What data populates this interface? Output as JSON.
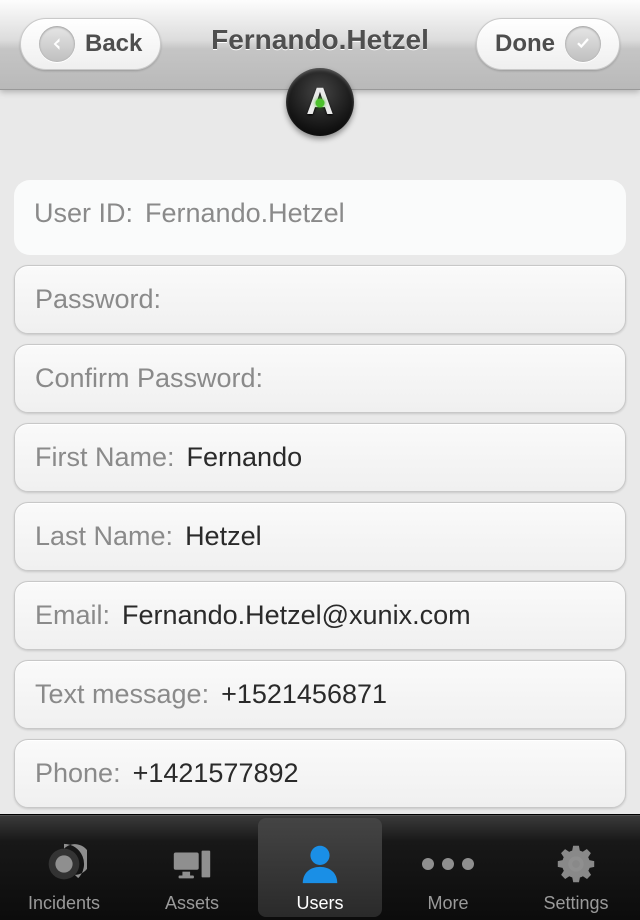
{
  "header": {
    "back_label": "Back",
    "done_label": "Done",
    "title": "Fernando.Hetzel"
  },
  "fields": {
    "user_id": {
      "label": "User ID:",
      "value": "Fernando.Hetzel"
    },
    "password": {
      "label": "Password:",
      "value": ""
    },
    "confirm": {
      "label": "Confirm Password:",
      "value": ""
    },
    "first_name": {
      "label": "First Name:",
      "value": "Fernando"
    },
    "last_name": {
      "label": "Last Name:",
      "value": "Hetzel"
    },
    "email": {
      "label": "Email:",
      "value": "Fernando.Hetzel@xunix.com"
    },
    "text_message": {
      "label": "Text message:",
      "value": "+1521456871"
    },
    "phone": {
      "label": "Phone:",
      "value": "+1421577892"
    }
  },
  "tabbar": {
    "incidents": "Incidents",
    "assets": "Assets",
    "users": "Users",
    "more": "More",
    "settings": "Settings",
    "active": "users"
  }
}
